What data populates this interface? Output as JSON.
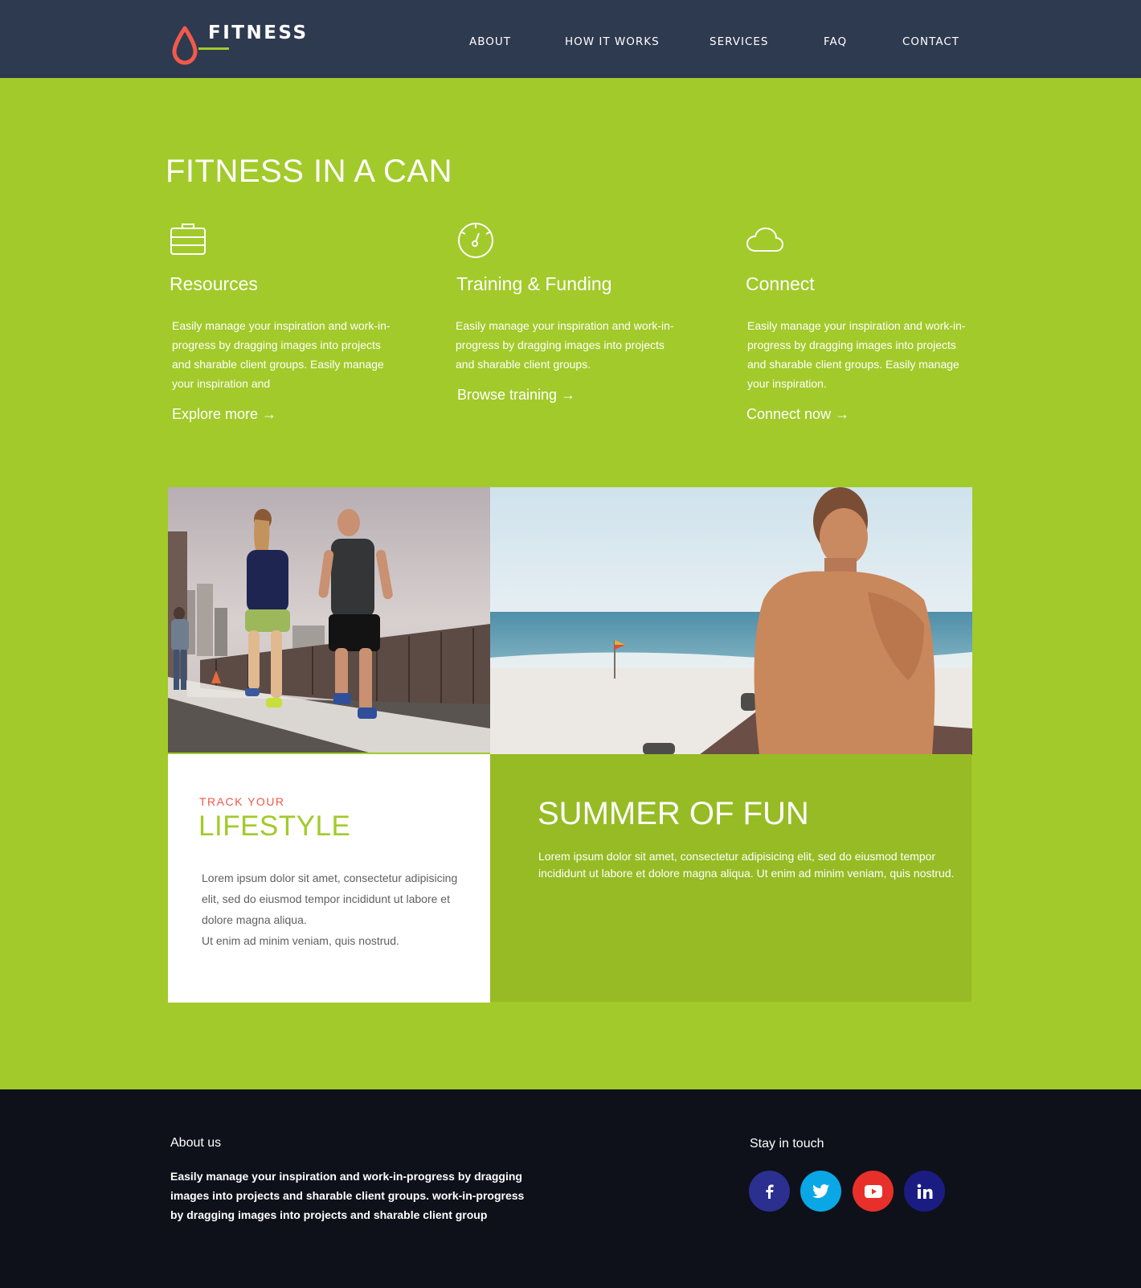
{
  "brand": {
    "name": "FITNESS",
    "accent": "#a2ca2a",
    "drop_color": "#f25a4b"
  },
  "nav": {
    "items": [
      "ABOUT",
      "HOW IT WORKS",
      "SERVICES",
      "FAQ",
      "CONTACT"
    ]
  },
  "hero": {
    "title": "FITNESS IN A CAN",
    "features": [
      {
        "icon": "briefcase-icon",
        "title": "Resources",
        "text": "Easily manage your inspiration and work-in-progress by dragging images into projects and sharable client groups. Easily manage your inspiration and",
        "link": "Explore more →"
      },
      {
        "icon": "speedometer-icon",
        "title": "Training & Funding",
        "text": "Easily manage your inspiration and work-in-progress by dragging images into projects and sharable client groups.",
        "link": "Browse training →"
      },
      {
        "icon": "cloud-icon",
        "title": "Connect",
        "text": "Easily manage your inspiration and work-in-progress by dragging images into projects and sharable client groups. Easily manage your inspiration.",
        "link": "Connect now →"
      }
    ]
  },
  "lifestyle": {
    "kicker": "TRACK YOUR",
    "title": "LIFESTYLE",
    "text1": "Lorem ipsum dolor sit amet, consectetur adipisicing elit, sed do eiusmod tempor incididunt ut labore et dolore magna aliqua.",
    "text2": "Ut enim ad minim veniam, quis nostrud."
  },
  "summer": {
    "title": "SUMMER OF FUN",
    "text": "Lorem ipsum dolor sit amet, consectetur adipisicing elit, sed do eiusmod tempor incididunt ut labore et dolore magna aliqua. Ut enim ad minim veniam, quis nostrud."
  },
  "footer": {
    "about_title": "About us",
    "about_text": "Easily manage your inspiration and work-in-progress by dragging images into projects and sharable client groups. work-in-progress by dragging images into projects and sharable client group",
    "stay_title": "Stay in touch",
    "social": [
      {
        "icon": "facebook-icon",
        "color": "#2b2f8f"
      },
      {
        "icon": "twitter-icon",
        "color": "#0aa7e6"
      },
      {
        "icon": "youtube-icon",
        "color": "#e8302a"
      },
      {
        "icon": "linkedin-icon",
        "color": "#1b1c82"
      }
    ]
  }
}
